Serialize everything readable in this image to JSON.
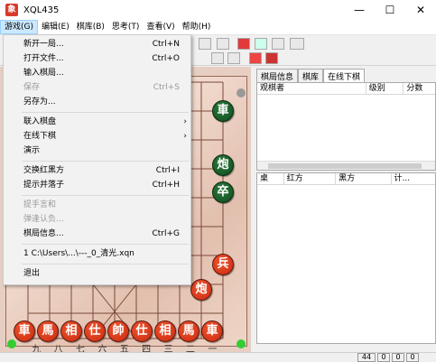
{
  "window": {
    "title": "XQL435",
    "app_icon": "xiangqi-icon",
    "minimize": "—",
    "maximize": "☐",
    "close": "✕"
  },
  "menubar": [
    "游戏(G)",
    "编辑(E)",
    "棋库(B)",
    "思考(T)",
    "查看(V)",
    "帮助(H)"
  ],
  "game_menu": {
    "items": [
      {
        "label": "新开一局...",
        "shortcut": "Ctrl+N"
      },
      {
        "label": "打开文件...",
        "shortcut": "Ctrl+O"
      },
      {
        "label": "输入棋局..."
      },
      {
        "label": "保存",
        "shortcut": "Ctrl+S",
        "disabled": true
      },
      {
        "label": "另存为..."
      },
      {
        "label": "联入棋盘",
        "submenu": true
      },
      {
        "label": "在线下棋",
        "submenu": true
      },
      {
        "label": "演示"
      },
      {
        "label": "交换红黑方",
        "shortcut": "Ctrl+I"
      },
      {
        "label": "提示并落子",
        "shortcut": "Ctrl+H"
      },
      {
        "label": "提手言和",
        "disabled": true
      },
      {
        "label": "弹逢认负...",
        "disabled": true
      },
      {
        "label": "棋局信息...",
        "shortcut": "Ctrl+G"
      },
      {
        "label": "1 C:\\Users\\...\\---_0_清光.xqn"
      },
      {
        "label": "退出"
      }
    ]
  },
  "right_panel": {
    "tabs": [
      "棋局信息",
      "棋库",
      "在线下棋"
    ],
    "players_columns": [
      "观棋者",
      "级别",
      "分数"
    ],
    "games_columns": [
      "桌",
      "红方",
      "黑方",
      "计..."
    ]
  },
  "board": {
    "bottom_row": [
      "車",
      "馬",
      "相",
      "仕",
      "帥",
      "仕",
      "相",
      "馬",
      "車"
    ],
    "bottom_labels": [
      "九",
      "八",
      "七",
      "六",
      "五",
      "四",
      "三",
      "二",
      "一"
    ],
    "visible_pieces": [
      {
        "text": "車",
        "side": "green"
      },
      {
        "text": "炮",
        "side": "green"
      },
      {
        "text": "卒",
        "side": "green"
      },
      {
        "text": "兵",
        "side": "red"
      },
      {
        "text": "炮",
        "side": "red"
      }
    ]
  },
  "status": {
    "count": "44",
    "v1": "0",
    "v2": "0",
    "v3": "0"
  },
  "colors": {
    "menu_highlight": "#cce8ff",
    "red_piece": "#d83a1c",
    "green_piece": "#1a5c2a"
  }
}
